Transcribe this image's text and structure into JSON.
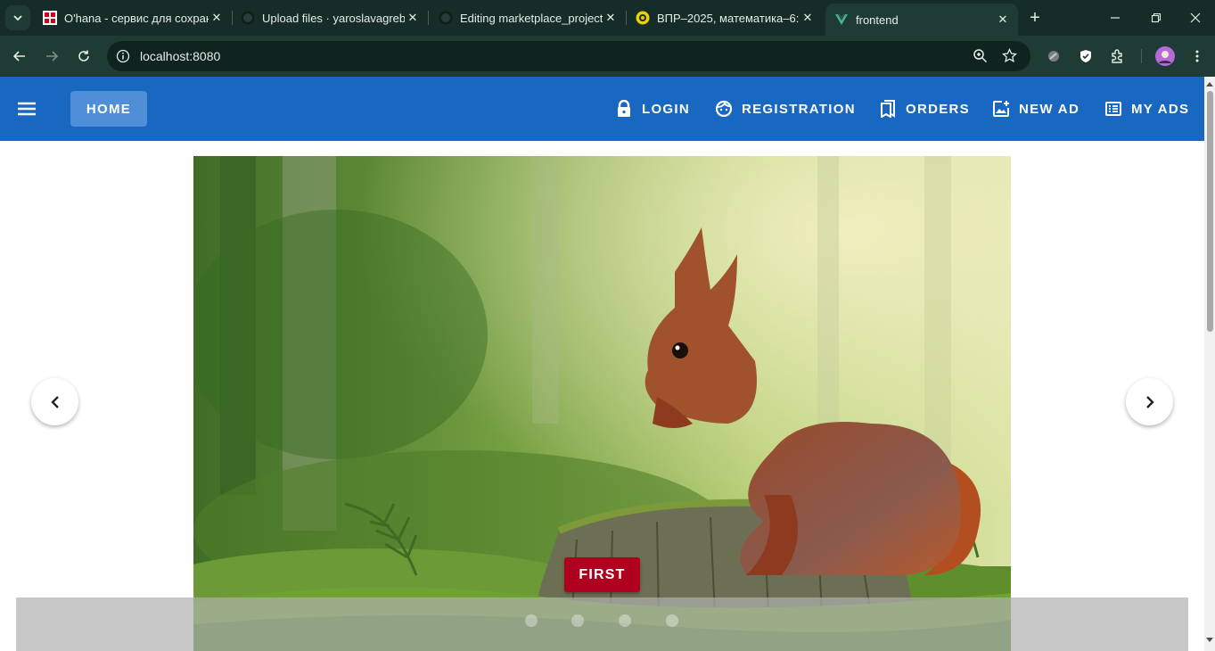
{
  "browser": {
    "tabs": [
      {
        "title": "O'hana - сервис для сохран",
        "icon": "ohana-logo"
      },
      {
        "title": "Upload files · yaroslavagrebe",
        "icon": "github-icon"
      },
      {
        "title": "Editing marketplace_project",
        "icon": "github-icon"
      },
      {
        "title": "ВПР–2025, математика–6: з",
        "icon": "vpr-icon"
      },
      {
        "title": "frontend",
        "icon": "vue-icon"
      }
    ],
    "url": "localhost:8080"
  },
  "app": {
    "nav": {
      "home": "HOME",
      "login": "LOGIN",
      "registration": "REGISTRATION",
      "orders": "ORDERS",
      "new_ad": "NEW AD",
      "my_ads": "MY ADS"
    },
    "carousel": {
      "button_label": "FIRST",
      "slide_count": 4,
      "active_index": 0
    }
  },
  "colors": {
    "appbar": "#1867c0",
    "home_button": "#4e8fd8",
    "first_button": "#b0001f",
    "chrome": "#152c28"
  }
}
